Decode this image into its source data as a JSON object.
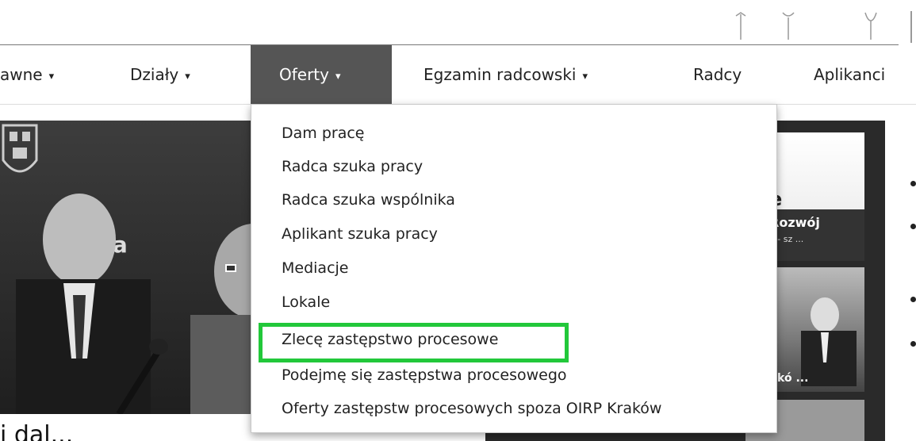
{
  "nav": {
    "items": [
      {
        "label": "awne",
        "caret": "▾"
      },
      {
        "label": "Działy",
        "caret": "▾"
      },
      {
        "label": "Oferty",
        "caret": "▾"
      },
      {
        "label": "Egzamin radcowski",
        "caret": "▾"
      },
      {
        "label": "Radcy",
        "caret": ""
      },
      {
        "label": "Aplikanci",
        "caret": ""
      }
    ],
    "active_index": 2
  },
  "dropdown": {
    "items": [
      "Dam pracę",
      "Radca szuka pracy",
      "Radca szuka wspólnika",
      "Aplikant szuka pracy",
      "Mediacje",
      "Lokale",
      "Zlecę zastępstwo procesowe",
      "Podejmę się zastępstwa procesowego",
      "Oferty zastępstw procesowych spoza OIRP Kraków"
    ],
    "highlighted_index": 6,
    "highlight_color": "#22c83a"
  },
  "hero": {
    "title": "wa",
    "caption": "i dal..."
  },
  "side": {
    "thumb1_title": "Rozwój",
    "thumb1_subtitle": "e - sz ...",
    "thumb1_letter": "e",
    "thumb2_caption": "dkó ..."
  },
  "colors": {
    "nav_active_bg": "#555555",
    "nav_text": "#222222"
  }
}
